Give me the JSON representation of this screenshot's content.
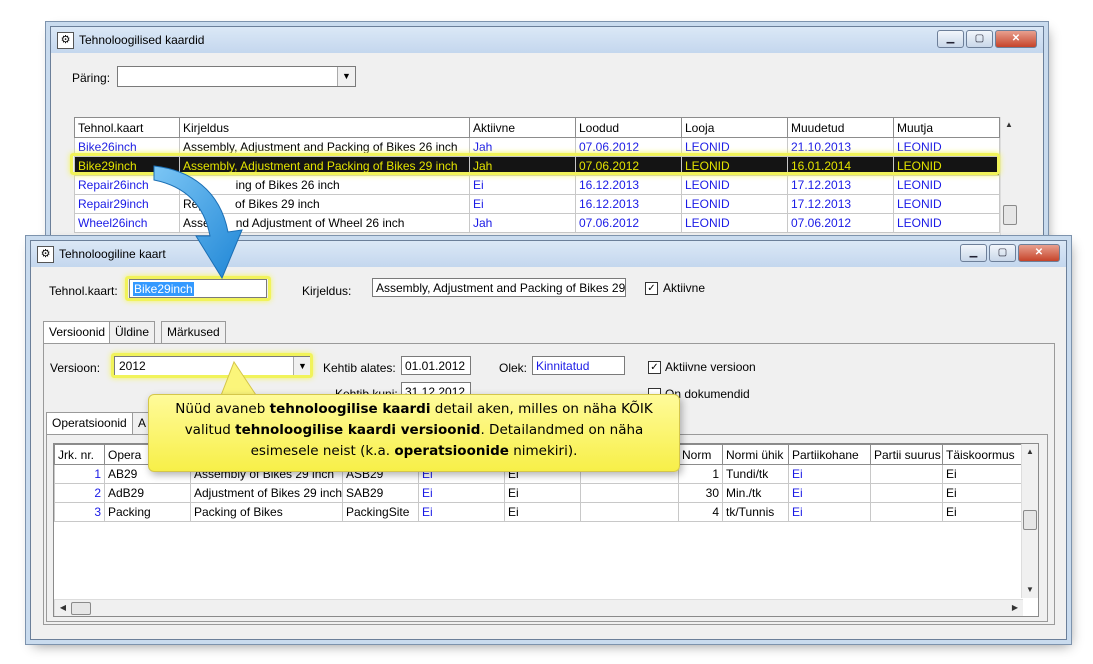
{
  "back_window": {
    "title": "Tehnoloogilised kaardid",
    "query_label": "Päring:",
    "query_value": "",
    "columns": [
      "Tehnol.kaart",
      "Kirjeldus",
      "Aktiivne",
      "Loodud",
      "Looja",
      "Muudetud",
      "Muutja"
    ],
    "rows": [
      [
        "Bike26inch",
        "Assembly, Adjustment and Packing of Bikes 26 inch",
        "Jah",
        "07.06.2012",
        "LEONID",
        "21.10.2013",
        "LEONID"
      ],
      [
        "Bike29inch",
        "Assembly, Adjustment and Packing of Bikes 29 inch",
        "Jah",
        "07.06.2012",
        "LEONID",
        "16.01.2014",
        "LEONID"
      ],
      [
        "Repair26inch",
        "R",
        "Ei",
        "16.12.2013",
        "LEONID",
        "17.12.2013",
        "LEONID"
      ],
      [
        "Repair29inch",
        "Rep",
        "Ei",
        "16.12.2013",
        "LEONID",
        "17.12.2013",
        "LEONID"
      ],
      [
        "Wheel26inch",
        "Assem",
        "Jah",
        "07.06.2012",
        "LEONID",
        "07.06.2012",
        "LEONID"
      ]
    ],
    "row_tails": [
      "",
      "",
      "ing of Bikes 26 inch",
      "of Bikes 29 inch",
      "nd Adjustment of Wheel 26 inch"
    ]
  },
  "front_window": {
    "title": "Tehnoloogiline kaart",
    "card_label": "Tehnol.kaart:",
    "card_value": "Bike29inch",
    "desc_label": "Kirjeldus:",
    "desc_value": "Assembly, Adjustment and Packing of Bikes 29 i",
    "active_label": "Aktiivne",
    "tabs": [
      "Versioonid",
      "Üldine",
      "Märkused"
    ],
    "version_label": "Versioon:",
    "version_value": "2012",
    "valid_from_label": "Kehtib alates:",
    "valid_from_value": "01.01.2012",
    "valid_to_label": "Kehtib kuni:",
    "valid_to_value": "31.12.2012",
    "state_label": "Olek:",
    "state_value": "Kinnitatud",
    "active_version_label": "Aktiivne versioon",
    "has_docs_label": "On dokumendid",
    "inner_tabs": [
      "Operatsioonid",
      "A"
    ],
    "columns": [
      "Jrk. nr.",
      "Opera",
      "",
      "",
      "",
      "",
      "r",
      "Norm",
      "Normi ühik",
      "Partiikohane",
      "Partii suurus",
      "Täiskoormus"
    ],
    "rows": [
      [
        "1",
        "AB29",
        "Assembly of Bikes 29 inch",
        "ASB29",
        "Ei",
        "Ei",
        "",
        "1",
        "Tundi/tk",
        "Ei",
        "",
        "Ei"
      ],
      [
        "2",
        "AdB29",
        "Adjustment of Bikes 29 inch",
        "SAB29",
        "Ei",
        "Ei",
        "",
        "30",
        "Min./tk",
        "Ei",
        "",
        "Ei"
      ],
      [
        "3",
        "Packing",
        "Packing of Bikes",
        "PackingSite",
        "Ei",
        "Ei",
        "",
        "4",
        "tk/Tunnis",
        "Ei",
        "",
        "Ei"
      ]
    ]
  },
  "callout": {
    "line1_a": "Nüüd avaneb ",
    "line1_b": "tehnoloogilise kaardi",
    "line1_c": " detail aken, milles on näha KÕIK",
    "line2_a": "valitud ",
    "line2_b": "tehnoloogilise kaardi versioonid",
    "line2_c": ".  Detailandmed on näha",
    "line3_a": "esimesele neist (k.a. ",
    "line3_b": "operatsioonide",
    "line3_c": " nimekiri)."
  },
  "colors": {
    "highlight": "#f1f35a",
    "link_blue": "#1a1ae6",
    "selected_row": "#141414",
    "callout": "#f7ef48",
    "arrow": "#3aa0e8"
  },
  "icons": [
    "app-icon",
    "minimize-icon",
    "maximize-icon",
    "close-icon",
    "dropdown-arrow-icon",
    "checkmark-icon",
    "scroll-up-icon",
    "scroll-down-icon",
    "scroll-left-icon",
    "scroll-right-icon"
  ]
}
